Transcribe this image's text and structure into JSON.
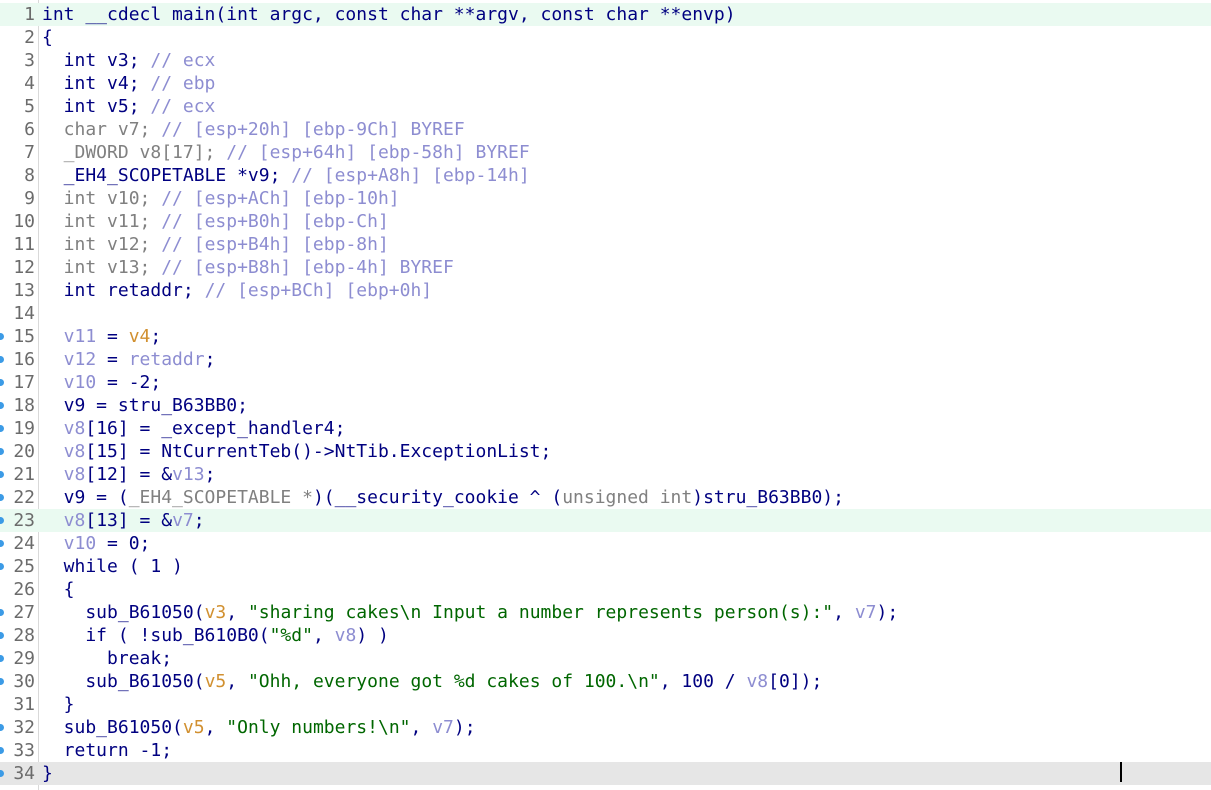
{
  "lines": [
    {
      "n": "1",
      "segments": [
        [
          "k",
          "int __cdecl main(int argc, const char **argv, const char **envp)"
        ]
      ],
      "bp": false,
      "hl": "green"
    },
    {
      "n": "2",
      "segments": [
        [
          "k",
          "{"
        ]
      ],
      "bp": false,
      "hl": ""
    },
    {
      "n": "3",
      "segments": [
        [
          "k",
          "  int v3; "
        ],
        [
          "c",
          "// ecx"
        ]
      ],
      "bp": false,
      "hl": ""
    },
    {
      "n": "4",
      "segments": [
        [
          "k",
          "  int v4; "
        ],
        [
          "c",
          "// ebp"
        ]
      ],
      "bp": false,
      "hl": ""
    },
    {
      "n": "5",
      "segments": [
        [
          "k",
          "  int v5; "
        ],
        [
          "c",
          "// ecx"
        ]
      ],
      "bp": false,
      "hl": ""
    },
    {
      "n": "6",
      "segments": [
        [
          "g",
          "  char v7; "
        ],
        [
          "c",
          "// [esp+20h] [ebp-9Ch] BYREF"
        ]
      ],
      "bp": false,
      "hl": ""
    },
    {
      "n": "7",
      "segments": [
        [
          "g",
          "  _DWORD v8[17]; "
        ],
        [
          "c",
          "// [esp+64h] [ebp-58h] BYREF"
        ]
      ],
      "bp": false,
      "hl": ""
    },
    {
      "n": "8",
      "segments": [
        [
          "k",
          "  _EH4_SCOPETABLE *v9; "
        ],
        [
          "c",
          "// [esp+A8h] [ebp-14h]"
        ]
      ],
      "bp": false,
      "hl": ""
    },
    {
      "n": "9",
      "segments": [
        [
          "g",
          "  int v10; "
        ],
        [
          "c",
          "// [esp+ACh] [ebp-10h]"
        ]
      ],
      "bp": false,
      "hl": ""
    },
    {
      "n": "10",
      "segments": [
        [
          "g",
          "  int v11; "
        ],
        [
          "c",
          "// [esp+B0h] [ebp-Ch]"
        ]
      ],
      "bp": false,
      "hl": ""
    },
    {
      "n": "11",
      "segments": [
        [
          "g",
          "  int v12; "
        ],
        [
          "c",
          "// [esp+B4h] [ebp-8h]"
        ]
      ],
      "bp": false,
      "hl": ""
    },
    {
      "n": "12",
      "segments": [
        [
          "g",
          "  int v13; "
        ],
        [
          "c",
          "// [esp+B8h] [ebp-4h] BYREF"
        ]
      ],
      "bp": false,
      "hl": ""
    },
    {
      "n": "13",
      "segments": [
        [
          "k",
          "  int retaddr; "
        ],
        [
          "c",
          "// [esp+BCh] [ebp+0h]"
        ]
      ],
      "bp": false,
      "hl": ""
    },
    {
      "n": "14",
      "segments": [
        [
          "k",
          ""
        ]
      ],
      "bp": false,
      "hl": ""
    },
    {
      "n": "15",
      "segments": [
        [
          "v",
          "  v11"
        ],
        [
          "k",
          " = "
        ],
        [
          "o",
          "v4"
        ],
        [
          "k",
          ";"
        ]
      ],
      "bp": true,
      "hl": ""
    },
    {
      "n": "16",
      "segments": [
        [
          "v",
          "  v12"
        ],
        [
          "k",
          " = "
        ],
        [
          "v",
          "retaddr"
        ],
        [
          "k",
          ";"
        ]
      ],
      "bp": true,
      "hl": ""
    },
    {
      "n": "17",
      "segments": [
        [
          "v",
          "  v10"
        ],
        [
          "k",
          " = -2;"
        ]
      ],
      "bp": true,
      "hl": ""
    },
    {
      "n": "18",
      "segments": [
        [
          "k",
          "  v9 = stru_B63BB0;"
        ]
      ],
      "bp": true,
      "hl": ""
    },
    {
      "n": "19",
      "segments": [
        [
          "v",
          "  v8"
        ],
        [
          "k",
          "[16] = _except_handler4;"
        ]
      ],
      "bp": true,
      "hl": ""
    },
    {
      "n": "20",
      "segments": [
        [
          "v",
          "  v8"
        ],
        [
          "k",
          "[15] = NtCurrentTeb()->NtTib.ExceptionList;"
        ]
      ],
      "bp": true,
      "hl": ""
    },
    {
      "n": "21",
      "segments": [
        [
          "v",
          "  v8"
        ],
        [
          "k",
          "[12] = &"
        ],
        [
          "v",
          "v13"
        ],
        [
          "k",
          ";"
        ]
      ],
      "bp": true,
      "hl": ""
    },
    {
      "n": "22",
      "segments": [
        [
          "k",
          "  v9 = ("
        ],
        [
          "g",
          "_EH4_SCOPETABLE *"
        ],
        [
          "k",
          ")(__security_cookie ^ ("
        ],
        [
          "g",
          "unsigned int"
        ],
        [
          "k",
          ")stru_B63BB0);"
        ]
      ],
      "bp": true,
      "hl": ""
    },
    {
      "n": "23",
      "segments": [
        [
          "v",
          "  v8"
        ],
        [
          "k",
          "[13] = &"
        ],
        [
          "v",
          "v7"
        ],
        [
          "k",
          ";"
        ]
      ],
      "bp": true,
      "hl": "green"
    },
    {
      "n": "24",
      "segments": [
        [
          "v",
          "  v10"
        ],
        [
          "k",
          " = 0;"
        ]
      ],
      "bp": true,
      "hl": ""
    },
    {
      "n": "25",
      "segments": [
        [
          "k",
          "  while ( 1 )"
        ]
      ],
      "bp": true,
      "hl": ""
    },
    {
      "n": "26",
      "segments": [
        [
          "k",
          "  {"
        ]
      ],
      "bp": false,
      "hl": ""
    },
    {
      "n": "27",
      "segments": [
        [
          "k",
          "    sub_B61050("
        ],
        [
          "o",
          "v3"
        ],
        [
          "k",
          ", "
        ],
        [
          "s",
          "\"sharing cakes\\n Input a number represents person(s):\""
        ],
        [
          "k",
          ", "
        ],
        [
          "v",
          "v7"
        ],
        [
          "k",
          ");"
        ]
      ],
      "bp": true,
      "hl": ""
    },
    {
      "n": "28",
      "segments": [
        [
          "k",
          "    if ( !sub_B610B0("
        ],
        [
          "s",
          "\"%d\""
        ],
        [
          "k",
          ", "
        ],
        [
          "v",
          "v8"
        ],
        [
          "k",
          ") )"
        ]
      ],
      "bp": true,
      "hl": ""
    },
    {
      "n": "29",
      "segments": [
        [
          "k",
          "      break;"
        ]
      ],
      "bp": true,
      "hl": ""
    },
    {
      "n": "30",
      "segments": [
        [
          "k",
          "    sub_B61050("
        ],
        [
          "o",
          "v5"
        ],
        [
          "k",
          ", "
        ],
        [
          "s",
          "\"Ohh, everyone got %d cakes of 100.\\n\""
        ],
        [
          "k",
          ", 100 / "
        ],
        [
          "v",
          "v8"
        ],
        [
          "k",
          "[0]);"
        ]
      ],
      "bp": true,
      "hl": ""
    },
    {
      "n": "31",
      "segments": [
        [
          "k",
          "  }"
        ]
      ],
      "bp": false,
      "hl": ""
    },
    {
      "n": "32",
      "segments": [
        [
          "k",
          "  sub_B61050("
        ],
        [
          "o",
          "v5"
        ],
        [
          "k",
          ", "
        ],
        [
          "s",
          "\"Only numbers!\\n\""
        ],
        [
          "k",
          ", "
        ],
        [
          "v",
          "v7"
        ],
        [
          "k",
          ");"
        ]
      ],
      "bp": true,
      "hl": ""
    },
    {
      "n": "33",
      "segments": [
        [
          "k",
          "  return -1;"
        ]
      ],
      "bp": true,
      "hl": ""
    },
    {
      "n": "34",
      "segments": [
        [
          "k",
          "}"
        ]
      ],
      "bp": true,
      "hl": "grey"
    }
  ]
}
